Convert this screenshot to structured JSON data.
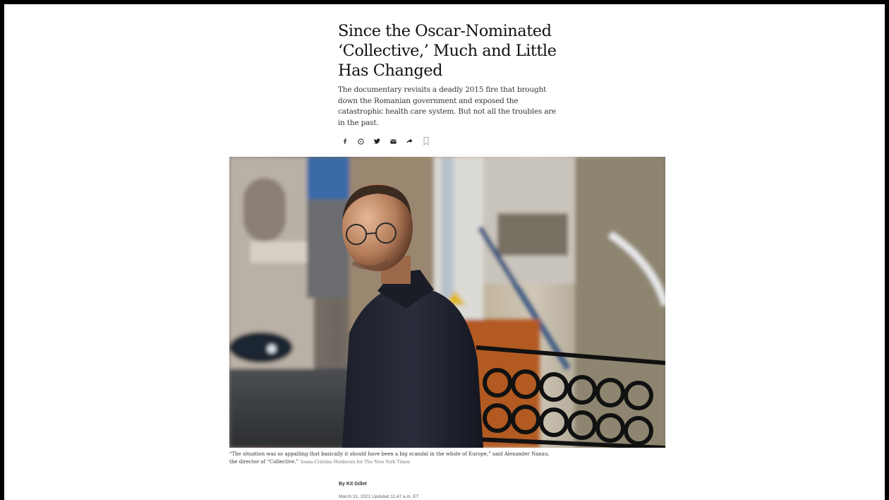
{
  "article": {
    "headline": "Since the Oscar-Nominated ‘Collective,’ Much and Little Has Changed",
    "summary": "The documentary revisits a deadly 2015 fire that brought down the Romanian government and exposed the catastrophic health care system. But not all the troubles are in the past.",
    "share_icons": [
      "facebook-icon",
      "whatsapp-icon",
      "twitter-icon",
      "email-icon",
      "share-icon",
      "bookmark-icon"
    ],
    "image": {
      "caption": "“The situation was so appalling that basically it should have been a big scandal in the whole of Europe,” said Alexander Nanau, the director of “Collective.”",
      "credit": "Ioana-Cristina Moldovan for The New York Times"
    },
    "byline_prefix": "By",
    "author": "Kit Gillet",
    "dateline": "March 31, 2021   Updated 11:47 a.m. ET"
  },
  "colors": {
    "frame": "#000000",
    "page": "#ffffff",
    "text": "#121212"
  }
}
